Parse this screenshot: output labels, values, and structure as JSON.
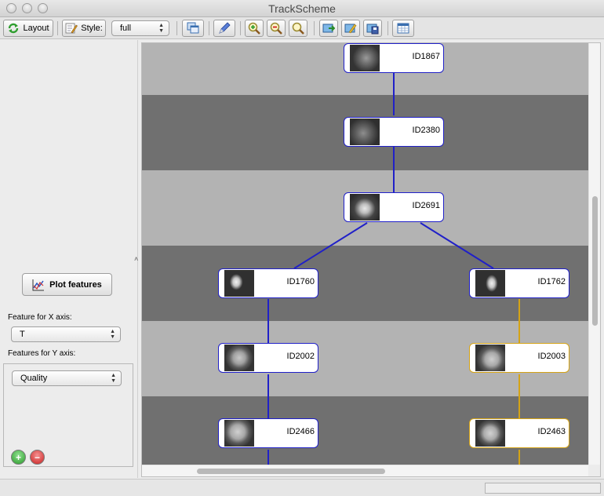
{
  "window": {
    "title": "TrackScheme"
  },
  "toolbar": {
    "layout_label": "Layout",
    "style_label": "Style:",
    "style_value": "full"
  },
  "left_panel": {
    "plot_features_label": "Plot features",
    "x_axis_label": "Feature for X axis:",
    "x_axis_value": "T",
    "y_axis_label": "Features for Y axis:",
    "y_axis_value": "Quality"
  },
  "track": {
    "nodes": [
      {
        "id": "ID1867"
      },
      {
        "id": "ID2380"
      },
      {
        "id": "ID2691"
      },
      {
        "id": "ID1760"
      },
      {
        "id": "ID1762"
      },
      {
        "id": "ID2002"
      },
      {
        "id": "ID2003"
      },
      {
        "id": "ID2466"
      },
      {
        "id": "ID2463"
      }
    ],
    "colors": {
      "selected_edge": "#2020c8",
      "other_edge": "#d4a316",
      "band_light": "#b3b3b3",
      "band_dark": "#707070"
    }
  }
}
